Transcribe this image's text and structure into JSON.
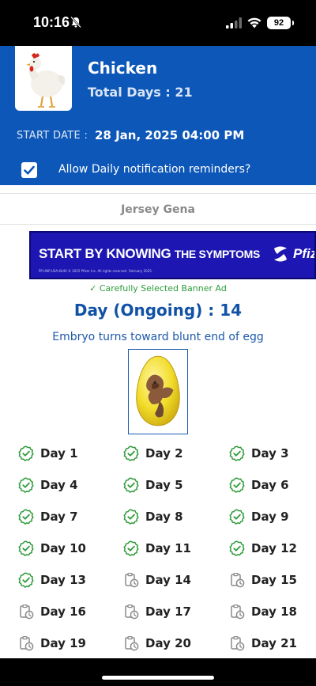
{
  "status_bar": {
    "time": "10:16",
    "battery": "92"
  },
  "header": {
    "name": "Chicken",
    "total_days": "Total Days : 21",
    "start_label": "START DATE :",
    "start_value": "28 Jan, 2025 04:00 PM",
    "notify_label": "Allow Daily notification reminders?",
    "notify_checked": true
  },
  "breed": "Jersey Gena",
  "banner": {
    "headline_bold": "START BY KNOWING",
    "headline_rest": "THE SYMPTOMS",
    "brand": "Pfiz",
    "fine_print": "PP-UNP-USA-6440 © 2025 Pfizer Inc. All rights reserved. February 2025.",
    "caption": "✓ Carefully Selected Banner Ad"
  },
  "current": {
    "title": "Day (Ongoing) : 14",
    "description": "Embryo turns toward blunt end of egg"
  },
  "days": [
    {
      "label": "Day 1",
      "status": "done"
    },
    {
      "label": "Day 2",
      "status": "done"
    },
    {
      "label": "Day 3",
      "status": "done"
    },
    {
      "label": "Day 4",
      "status": "done"
    },
    {
      "label": "Day 5",
      "status": "done"
    },
    {
      "label": "Day 6",
      "status": "done"
    },
    {
      "label": "Day 7",
      "status": "done"
    },
    {
      "label": "Day 8",
      "status": "done"
    },
    {
      "label": "Day 9",
      "status": "done"
    },
    {
      "label": "Day 10",
      "status": "done"
    },
    {
      "label": "Day 11",
      "status": "done"
    },
    {
      "label": "Day 12",
      "status": "done"
    },
    {
      "label": "Day 13",
      "status": "done"
    },
    {
      "label": "Day 14",
      "status": "pending"
    },
    {
      "label": "Day 15",
      "status": "pending"
    },
    {
      "label": "Day 16",
      "status": "pending"
    },
    {
      "label": "Day 17",
      "status": "pending"
    },
    {
      "label": "Day 18",
      "status": "pending"
    },
    {
      "label": "Day 19",
      "status": "pending"
    },
    {
      "label": "Day 20",
      "status": "pending"
    },
    {
      "label": "Day 21",
      "status": "pending"
    }
  ],
  "colors": {
    "header_blue": "#0d57b8",
    "title_blue": "#1152a6",
    "done_green": "#2e9b3a",
    "pending_gray": "#8a8a8a",
    "banner_blue": "#1d16b3"
  },
  "icons": {
    "done": "check-badge-icon",
    "pending": "clipboard-clock-icon"
  }
}
